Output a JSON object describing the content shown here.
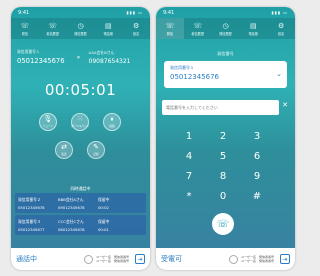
{
  "status": {
    "time": "9:41"
  },
  "nav": [
    {
      "icon": "phone-icon",
      "label": "発信"
    },
    {
      "icon": "history-icon",
      "label": "着信履歴"
    },
    {
      "icon": "clock-icon",
      "label": "発信履歴"
    },
    {
      "icon": "book-icon",
      "label": "電話帳"
    },
    {
      "icon": "gear-icon",
      "label": "設定"
    }
  ],
  "screen1": {
    "caller_left": {
      "name": "発信用番号１",
      "number": "05012345676"
    },
    "caller_right": {
      "name": "AAA会社Bさん",
      "number": "09087654321"
    },
    "timer": "00:05:01",
    "controls": [
      {
        "icon": "mute-icon",
        "label": "ミュート"
      },
      {
        "icon": "keypad-icon",
        "label": "ダイヤルパッド"
      },
      {
        "icon": "hold-icon",
        "label": "保留"
      },
      {
        "icon": "transfer-icon",
        "label": "転送"
      },
      {
        "icon": "record-icon",
        "label": "記録"
      }
    ],
    "section_title": "同時通話中",
    "calls": [
      {
        "c1a": "発信用番号２",
        "c1b": "05012345678",
        "c2a": "BBB会社Aさん",
        "c2b": "09012345678",
        "c3a": "保留中",
        "c3b": "00:02"
      },
      {
        "c1a": "発信用番号３",
        "c1b": "05012345677",
        "c2a": "CCC会社Cさん",
        "c2b": "08012345678",
        "c3a": "保留中",
        "c3b": "00:01"
      }
    ],
    "bottom_status": "通話中",
    "user_label_1": "ユーザー名　発信者番号",
    "user_label_2": "ユーザー名　発信者番号",
    "exit_icon": "exit-icon"
  },
  "screen2": {
    "title": "発信番号",
    "line_name": "発信用番号１",
    "line_number": "05012345676",
    "dial_placeholder": "電話番号を入力してください",
    "keys": [
      "1",
      "2",
      "3",
      "4",
      "5",
      "6",
      "7",
      "8",
      "9",
      "*",
      "0",
      "#"
    ],
    "bottom_status": "受電可",
    "user_label_1": "ユーザー名　発信者番号",
    "user_label_2": "ユーザー名　発信者番号"
  }
}
